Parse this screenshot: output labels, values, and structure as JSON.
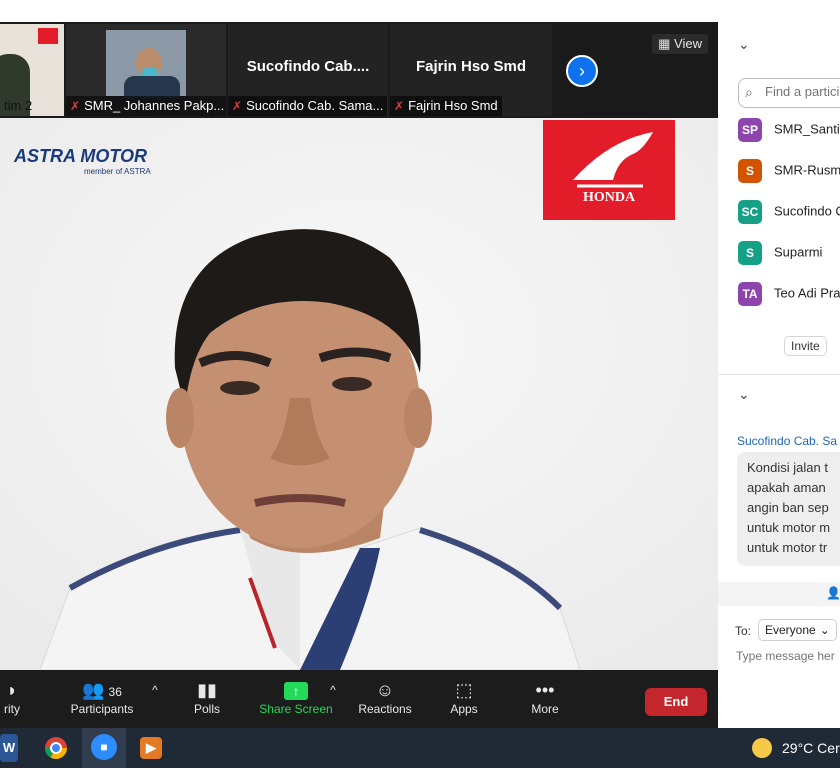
{
  "meeting": {
    "view_label": "View",
    "thumbnails": [
      {
        "name": "tim 2"
      },
      {
        "name": "SMR_ Johannes Pakp..."
      },
      {
        "name": "Sucofindo Cab. Sama...",
        "display": "Sucofindo  Cab...."
      },
      {
        "name": "Fajrin Hso Smd",
        "display": "Fajrin Hso Smd"
      }
    ],
    "main_video": {
      "brand_left": "ASTRA MOTOR",
      "brand_left_sub": "member of ASTRA",
      "brand_right": "HONDA"
    }
  },
  "toolbar": {
    "security": "rity",
    "participants": "Participants",
    "participants_count": "36",
    "polls": "Polls",
    "share": "Share Screen",
    "reactions": "Reactions",
    "apps": "Apps",
    "more": "More",
    "end": "End"
  },
  "participants_panel": {
    "search_placeholder": "Find a partici",
    "items": [
      {
        "initials": "SP",
        "name": "SMR_Santi",
        "color": "#8e44ad"
      },
      {
        "initials": "S",
        "name": "SMR-Rusm",
        "color": "#d35400"
      },
      {
        "initials": "SC",
        "name": "Sucofindo C",
        "color": "#16a085"
      },
      {
        "initials": "S",
        "name": "Suparmi",
        "color": "#16a085"
      },
      {
        "initials": "TA",
        "name": "Teo Adi Pra",
        "color": "#8e44ad"
      }
    ],
    "invite_label": "Invite"
  },
  "chat": {
    "sender": "Sucofindo Cab. Sa",
    "message_lines": [
      "Kondisi jalan t",
      "apakah aman",
      "angin ban sep",
      "untuk motor m",
      "untuk motor tr"
    ],
    "to_label": "To:",
    "recipient": "Everyone",
    "input_placeholder": "Type message her"
  },
  "taskbar": {
    "weather": "29°C",
    "weather_desc": "Cer"
  },
  "colors": {
    "accent_blue": "#0e72ed",
    "end_red": "#c4262e",
    "share_green": "#23d959",
    "honda_red": "#e31c2a"
  }
}
